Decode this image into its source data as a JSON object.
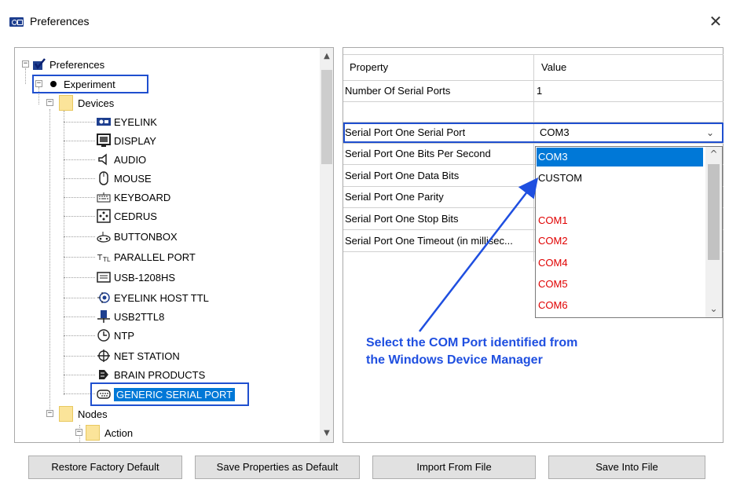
{
  "window": {
    "title": "Preferences",
    "close_glyph": "✕"
  },
  "tree": {
    "root": "Preferences",
    "experiment": "Experiment",
    "devices": "Devices",
    "device_items": [
      {
        "label": "EYELINK",
        "icon": "eyelink-icon"
      },
      {
        "label": "DISPLAY",
        "icon": "display-icon"
      },
      {
        "label": "AUDIO",
        "icon": "speaker-icon"
      },
      {
        "label": "MOUSE",
        "icon": "mouse-icon"
      },
      {
        "label": "KEYBOARD",
        "icon": "keyboard-icon"
      },
      {
        "label": "CEDRUS",
        "icon": "cedrus-icon"
      },
      {
        "label": "BUTTONBOX",
        "icon": "gamepad-icon"
      },
      {
        "label": "PARALLEL PORT",
        "icon": "parallel-port-icon"
      },
      {
        "label": "USB-1208HS",
        "icon": "usb-box-icon"
      },
      {
        "label": "EYELINK HOST TTL",
        "icon": "ttl-icon"
      },
      {
        "label": "USB2TTL8",
        "icon": "usb-ttl-icon"
      },
      {
        "label": "NTP",
        "icon": "clock-icon"
      },
      {
        "label": "NET STATION",
        "icon": "net-station-icon"
      },
      {
        "label": "BRAIN PRODUCTS",
        "icon": "brain-products-icon"
      },
      {
        "label": "GENERIC SERIAL PORT",
        "icon": "serial-port-icon"
      }
    ],
    "nodes": "Nodes",
    "action": "Action"
  },
  "grid": {
    "header_property": "Property",
    "header_value": "Value",
    "rows": [
      {
        "property": "Number Of Serial Ports",
        "value": "1"
      },
      {
        "property": "",
        "value": ""
      },
      {
        "property": "Serial Port One Serial Port",
        "value": "COM3"
      },
      {
        "property": "Serial Port One Bits Per Second",
        "value": ""
      },
      {
        "property": "Serial Port One Data Bits",
        "value": ""
      },
      {
        "property": "Serial Port One Parity",
        "value": ""
      },
      {
        "property": "Serial Port One Stop Bits",
        "value": ""
      },
      {
        "property": "Serial Port One Timeout (in millisec...",
        "value": ""
      }
    ]
  },
  "dropdown": {
    "selected": "COM3",
    "options": [
      {
        "label": "COM3",
        "color": "#ffffff",
        "highlighted": true
      },
      {
        "label": "CUSTOM",
        "color": "#000000"
      },
      {
        "label": "",
        "color": "#000000"
      },
      {
        "label": "COM1",
        "color": "#e00000"
      },
      {
        "label": "COM2",
        "color": "#e00000"
      },
      {
        "label": "COM4",
        "color": "#e00000"
      },
      {
        "label": "COM5",
        "color": "#e00000"
      },
      {
        "label": "COM6",
        "color": "#e00000"
      }
    ]
  },
  "annotation": {
    "line1": "Select the COM Port identified from",
    "line2": "the Windows Device Manager"
  },
  "buttons": {
    "restore": "Restore Factory Default",
    "save_props": "Save Properties as Default",
    "import": "Import From File",
    "save_file": "Save Into File"
  },
  "colors": {
    "accent": "#1f4fcf",
    "selection": "#0078d7",
    "annotation": "#1f4fe0",
    "port_red": "#e00000"
  }
}
